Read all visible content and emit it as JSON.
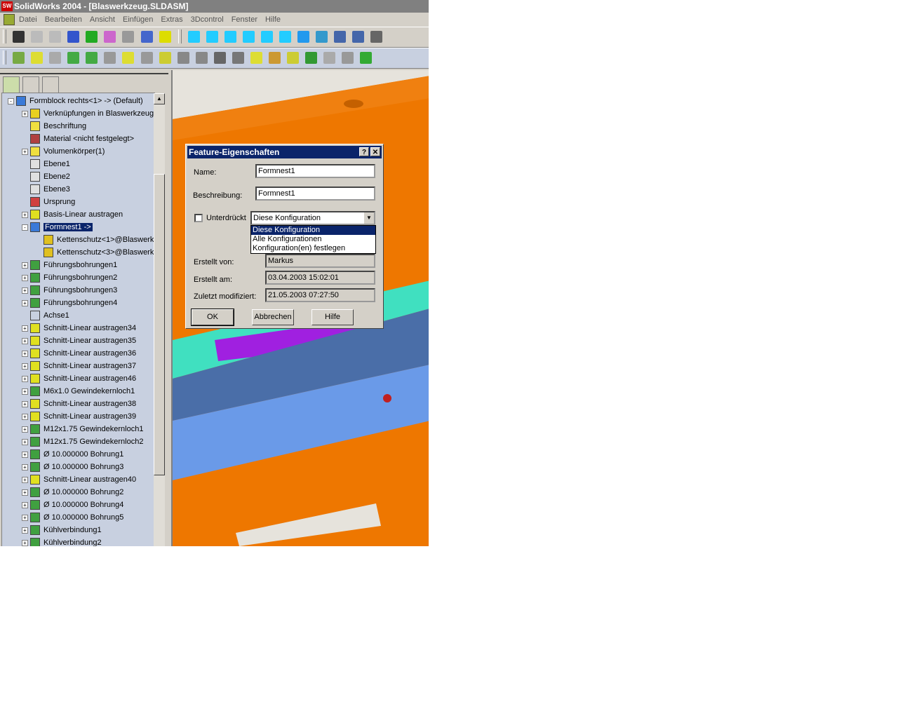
{
  "window": {
    "title": "SolidWorks 2004 - [Blaswerkzeug.SLDASM]",
    "logo": "SW"
  },
  "menu": [
    "Datei",
    "Bearbeiten",
    "Ansicht",
    "Einfügen",
    "Extras",
    "3Dcontrol",
    "Fenster",
    "Hilfe"
  ],
  "tree": [
    {
      "label": "Formblock rechts<1> -> (Default)",
      "level": 0,
      "exp": "-",
      "color": "#3a7ad8"
    },
    {
      "label": "Verknüpfungen in Blaswerkzeug",
      "level": 1,
      "exp": "+",
      "color": "#e8d020"
    },
    {
      "label": "Beschriftung",
      "level": 1,
      "exp": "",
      "color": "#f0e040"
    },
    {
      "label": "Material <nicht festgelegt>",
      "level": 1,
      "exp": "",
      "color": "#b04040"
    },
    {
      "label": "Volumenkörper(1)",
      "level": 1,
      "exp": "+",
      "color": "#f0e040"
    },
    {
      "label": "Ebene1",
      "level": 1,
      "exp": "",
      "color": "#e0e0e0"
    },
    {
      "label": "Ebene2",
      "level": 1,
      "exp": "",
      "color": "#e0e0e0"
    },
    {
      "label": "Ebene3",
      "level": 1,
      "exp": "",
      "color": "#e0e0e0"
    },
    {
      "label": "Ursprung",
      "level": 1,
      "exp": "",
      "color": "#d04040"
    },
    {
      "label": "Basis-Linear austragen",
      "level": 1,
      "exp": "+",
      "color": "#e0e020"
    },
    {
      "label": "Formnest1 ->",
      "level": 1,
      "exp": "-",
      "color": "#3a7ad8",
      "selected": true
    },
    {
      "label": "Kettenschutz<1>@Blaswerk",
      "level": 2,
      "exp": "",
      "color": "#e0c020"
    },
    {
      "label": "Kettenschutz<3>@Blaswerk",
      "level": 2,
      "exp": "",
      "color": "#e0c020"
    },
    {
      "label": "Führungsbohrungen1",
      "level": 1,
      "exp": "+",
      "color": "#40a040"
    },
    {
      "label": "Führungsbohrungen2",
      "level": 1,
      "exp": "+",
      "color": "#40a040"
    },
    {
      "label": "Führungsbohrungen3",
      "level": 1,
      "exp": "+",
      "color": "#40a040"
    },
    {
      "label": "Führungsbohrungen4",
      "level": 1,
      "exp": "+",
      "color": "#40a040"
    },
    {
      "label": "Achse1",
      "level": 1,
      "exp": "",
      "color": "#c8d0e0"
    },
    {
      "label": "Schnitt-Linear austragen34",
      "level": 1,
      "exp": "+",
      "color": "#e0e020"
    },
    {
      "label": "Schnitt-Linear austragen35",
      "level": 1,
      "exp": "+",
      "color": "#e0e020"
    },
    {
      "label": "Schnitt-Linear austragen36",
      "level": 1,
      "exp": "+",
      "color": "#e0e020"
    },
    {
      "label": "Schnitt-Linear austragen37",
      "level": 1,
      "exp": "+",
      "color": "#e0e020"
    },
    {
      "label": "Schnitt-Linear austragen46",
      "level": 1,
      "exp": "+",
      "color": "#e0e020"
    },
    {
      "label": "M6x1.0 Gewindekernloch1",
      "level": 1,
      "exp": "+",
      "color": "#40a040"
    },
    {
      "label": "Schnitt-Linear austragen38",
      "level": 1,
      "exp": "+",
      "color": "#e0e020"
    },
    {
      "label": "Schnitt-Linear austragen39",
      "level": 1,
      "exp": "+",
      "color": "#e0e020"
    },
    {
      "label": "M12x1.75 Gewindekernloch1",
      "level": 1,
      "exp": "+",
      "color": "#40a040"
    },
    {
      "label": "M12x1.75 Gewindekernloch2",
      "level": 1,
      "exp": "+",
      "color": "#40a040"
    },
    {
      "label": "Ø 10.000000 Bohrung1",
      "level": 1,
      "exp": "+",
      "color": "#40a040"
    },
    {
      "label": "Ø 10.000000 Bohrung3",
      "level": 1,
      "exp": "+",
      "color": "#40a040"
    },
    {
      "label": "Schnitt-Linear austragen40",
      "level": 1,
      "exp": "+",
      "color": "#e0e020"
    },
    {
      "label": "Ø 10.000000 Bohrung2",
      "level": 1,
      "exp": "+",
      "color": "#40a040"
    },
    {
      "label": "Ø 10.000000 Bohrung4",
      "level": 1,
      "exp": "+",
      "color": "#40a040"
    },
    {
      "label": "Ø 10.000000 Bohrung5",
      "level": 1,
      "exp": "+",
      "color": "#40a040"
    },
    {
      "label": "Kühlverbindung1",
      "level": 1,
      "exp": "+",
      "color": "#40a040"
    },
    {
      "label": "Kühlverbindung2",
      "level": 1,
      "exp": "+",
      "color": "#40a040"
    }
  ],
  "dialog": {
    "title": "Feature-Eigenschaften",
    "help": "?",
    "close": "✕",
    "name_label": "Name:",
    "name_value": "Formnest1",
    "desc_label": "Beschreibung:",
    "desc_value": "Formnest1",
    "suppressed_label": "Unterdrückt",
    "suppressed_checked": false,
    "config_value": "Diese Konfiguration",
    "config_options": [
      "Diese Konfiguration",
      "Alle Konfigurationen",
      "Konfiguration(en) festlegen"
    ],
    "created_by_label": "Erstellt von:",
    "created_by": "Markus",
    "created_on_label": "Erstellt am:",
    "created_on": "03.04.2003 15:02:01",
    "modified_label": "Zuletzt modifiziert:",
    "modified": "21.05.2003 07:27:50",
    "ok": "OK",
    "cancel": "Abbrechen",
    "help_btn": "Hilfe"
  }
}
